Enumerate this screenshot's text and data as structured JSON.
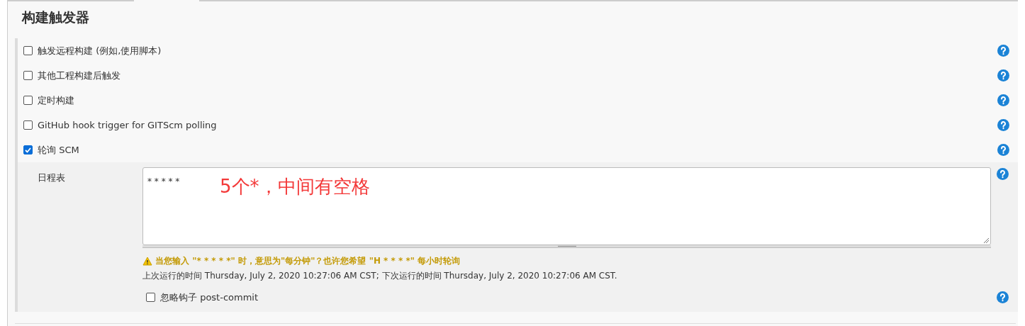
{
  "section_title": "构建触发器",
  "triggers": [
    {
      "label": "触发远程构建 (例如,使用脚本)",
      "checked": false
    },
    {
      "label": "其他工程构建后触发",
      "checked": false
    },
    {
      "label": "定时构建",
      "checked": false
    },
    {
      "label": "GitHub hook trigger for GITScm polling",
      "checked": false
    },
    {
      "label": "轮询 SCM",
      "checked": true
    }
  ],
  "schedule": {
    "label": "日程表",
    "value": "* * * * *",
    "annotation": "5个*，中间有空格",
    "warning": "当您输入 \"* * * * *\" 时，意思为\"每分钟\"？也许您希望 \"H * * * *\" 每小时轮询",
    "run_info": "上次运行的时间 Thursday, July 2, 2020 10:27:06 AM CST; 下次运行的时间 Thursday, July 2, 2020 10:27:06 AM CST."
  },
  "ignore_hook": {
    "label": "忽略钩子 post-commit",
    "checked": false
  }
}
